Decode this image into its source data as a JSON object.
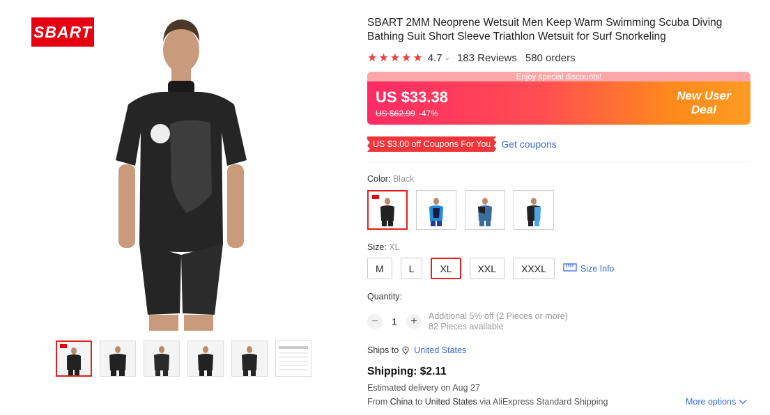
{
  "brand": {
    "logo_text": "SBART",
    "color": "#e60012"
  },
  "product": {
    "title": "SBART 2MM Neoprene Wetsuit Men Keep Warm Swimming Scuba Diving Bathing Suit Short Sleeve Triathlon Wetsuit for Surf Snorkeling",
    "rating": "4.7",
    "rating_stars": 5,
    "reviews": "183 Reviews",
    "orders": "580 orders"
  },
  "promo": {
    "strip_text": "Enjoy special discounts!",
    "price": "US $33.38",
    "original_price": "US $62.99",
    "discount": "-47%",
    "badge_line1": "New User",
    "badge_line2": "Deal"
  },
  "coupon": {
    "tag": "US $3.00 off Coupons For You",
    "link": "Get coupons"
  },
  "color": {
    "label": "Color:",
    "selected": "Black",
    "options": [
      {
        "name": "Black",
        "accent": "#222222"
      },
      {
        "name": "Blue",
        "accent": "#1e8fd6"
      },
      {
        "name": "Navy",
        "accent": "#3a6e9e"
      },
      {
        "name": "Sky",
        "accent": "#49a6e8"
      }
    ]
  },
  "size": {
    "label": "Size:",
    "selected": "XL",
    "options": [
      "M",
      "L",
      "XL",
      "XXL",
      "XXXL"
    ],
    "info_link": "Size Info"
  },
  "quantity": {
    "label": "Quantity:",
    "minus": "−",
    "plus": "+",
    "value": "1",
    "note_line1": "Additional 5% off (2 Pieces or more)",
    "note_line2": "82 Pieces available"
  },
  "shipping": {
    "ships_to_label": "Ships to",
    "destination": "United States",
    "price": "Shipping: $2.11",
    "delivery": "Estimated delivery on Aug 27",
    "from_label": "From",
    "from": "China",
    "to_label": "to",
    "to": "United States",
    "via_label": "via",
    "carrier": "AliExpress Standard Shipping",
    "more_options": "More options"
  },
  "gallery": {
    "thumb_count": 6,
    "active_index": 0
  }
}
